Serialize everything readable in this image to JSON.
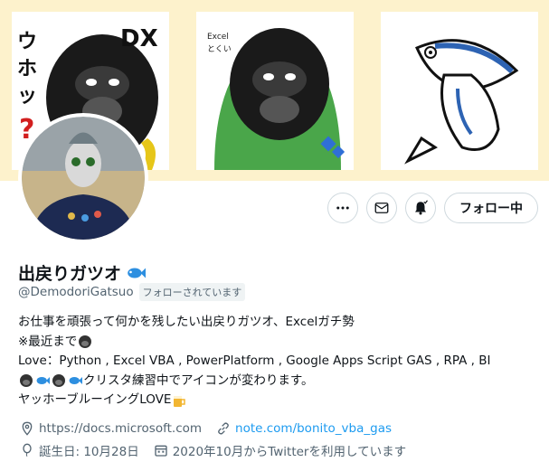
{
  "profile": {
    "display_name": "出戻りガツオ",
    "handle": "@DemodoriGatsuo",
    "follows_you_badge": "フォローされています",
    "follow_button": "フォロー中",
    "bio": {
      "line1": "お仕事を頑張って何かを残したい出戻りガツオ、Excelガチ勢",
      "line2": "※最近まで",
      "line3": "Love：Python , Excel VBA , PowerPlatform , Google Apps Script GAS , RPA , BI",
      "line4_suffix": "クリスタ練習中でアイコンが変わります。",
      "line5": "ヤッホーブルーイングLOVE"
    },
    "meta": {
      "website": "https://docs.microsoft.com",
      "link": "note.com/bonito_vba_gas",
      "birthday": "誕生日: 10月28日",
      "joined": "2020年10月からTwitterを利用しています"
    }
  },
  "banner": {
    "tile1_text": "DX ウホッ？",
    "tile2_text": "Excelとくい"
  },
  "colors": {
    "banner_bg": "#fdf2cc",
    "link": "#1d9bf0",
    "muted": "#536471",
    "border": "#cfd9de"
  }
}
